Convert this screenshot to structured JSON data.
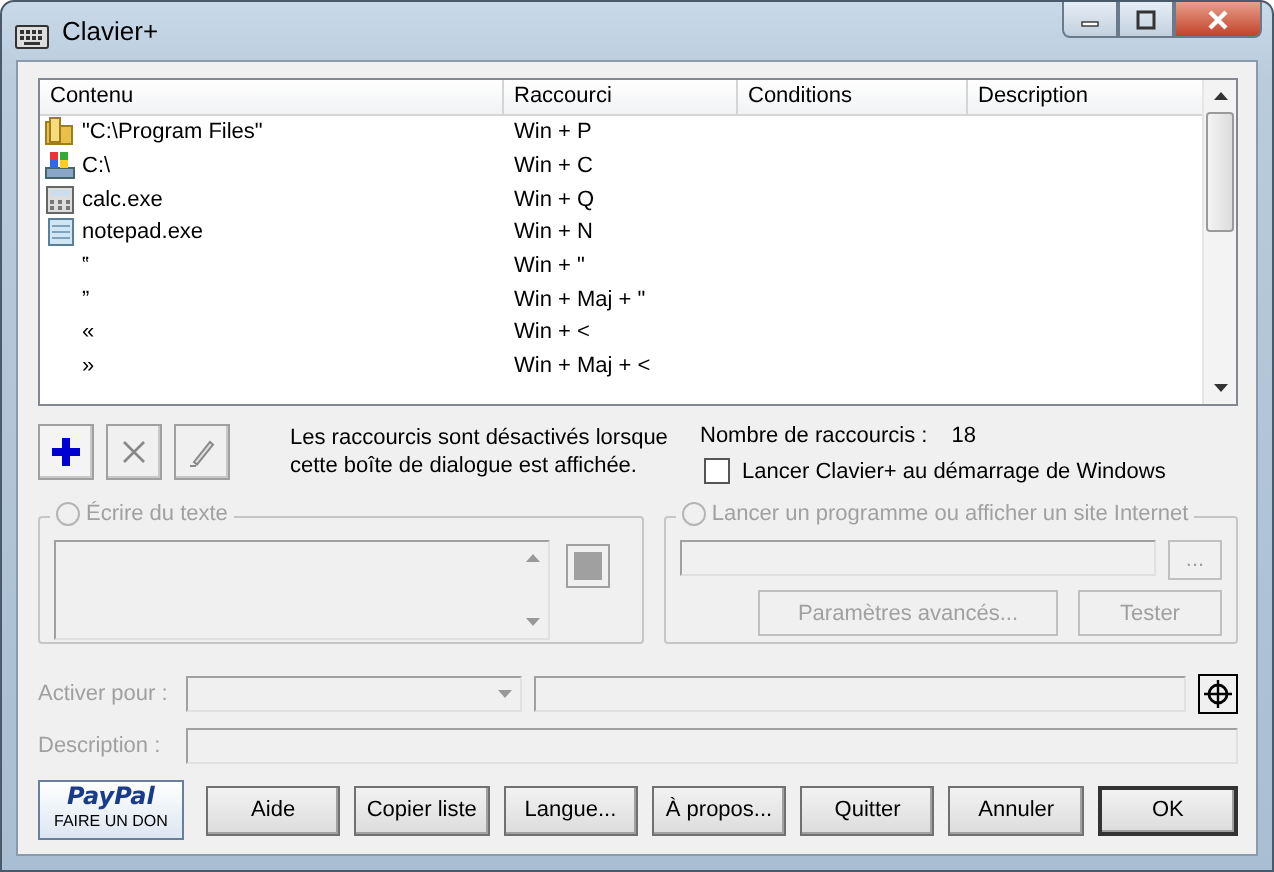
{
  "window": {
    "title": "Clavier+"
  },
  "list": {
    "columns": [
      "Contenu",
      "Raccourci",
      "Conditions",
      "Description"
    ],
    "rows": [
      {
        "kind": "folder",
        "content": "\"C:\\Program Files\"",
        "shortcut": "Win + P"
      },
      {
        "kind": "drive",
        "content": "C:\\",
        "shortcut": "Win + C"
      },
      {
        "kind": "calculator",
        "content": "calc.exe",
        "shortcut": "Win + Q"
      },
      {
        "kind": "notepad",
        "content": "notepad.exe",
        "shortcut": "Win + N"
      },
      {
        "kind": "text",
        "content": "‟",
        "shortcut": "Win + \""
      },
      {
        "kind": "text",
        "content": "”",
        "shortcut": "Win + Maj + \""
      },
      {
        "kind": "text",
        "content": "«",
        "shortcut": "Win + <"
      },
      {
        "kind": "text",
        "content": "»",
        "shortcut": "Win + Maj + <"
      }
    ]
  },
  "toolbar": [
    {
      "kind": "add",
      "disabled": false
    },
    {
      "kind": "delete",
      "disabled": true
    },
    {
      "kind": "edit",
      "disabled": true
    }
  ],
  "info": "Les raccourcis sont désactivés lorsque cette boîte de dialogue est affichée.",
  "count": {
    "label": "Nombre de raccourcis :",
    "value": "18"
  },
  "startup": {
    "label": "Lancer Clavier+ au démarrage de Windows",
    "checked": false
  },
  "write_text": {
    "label": "Écrire du texte",
    "selected": false,
    "disabled": true
  },
  "launch": {
    "label": "Lancer un programme ou afficher un site Internet",
    "selected": false,
    "disabled": true,
    "browse": "...",
    "advanced": "Paramètres avancés...",
    "test": "Tester"
  },
  "activate": {
    "label": "Activer pour :",
    "disabled": true
  },
  "description": {
    "label": "Description :",
    "disabled": true
  },
  "donate": {
    "brand": "PayPal",
    "text": "FAIRE UN DON"
  },
  "buttons": [
    {
      "label": "Aide",
      "default": false
    },
    {
      "label": "Copier liste",
      "default": false
    },
    {
      "label": "Langue...",
      "default": false
    },
    {
      "label": "À propos...",
      "default": false
    },
    {
      "label": "Quitter",
      "default": false
    },
    {
      "label": "Annuler",
      "default": false
    },
    {
      "label": "OK",
      "default": true
    }
  ]
}
